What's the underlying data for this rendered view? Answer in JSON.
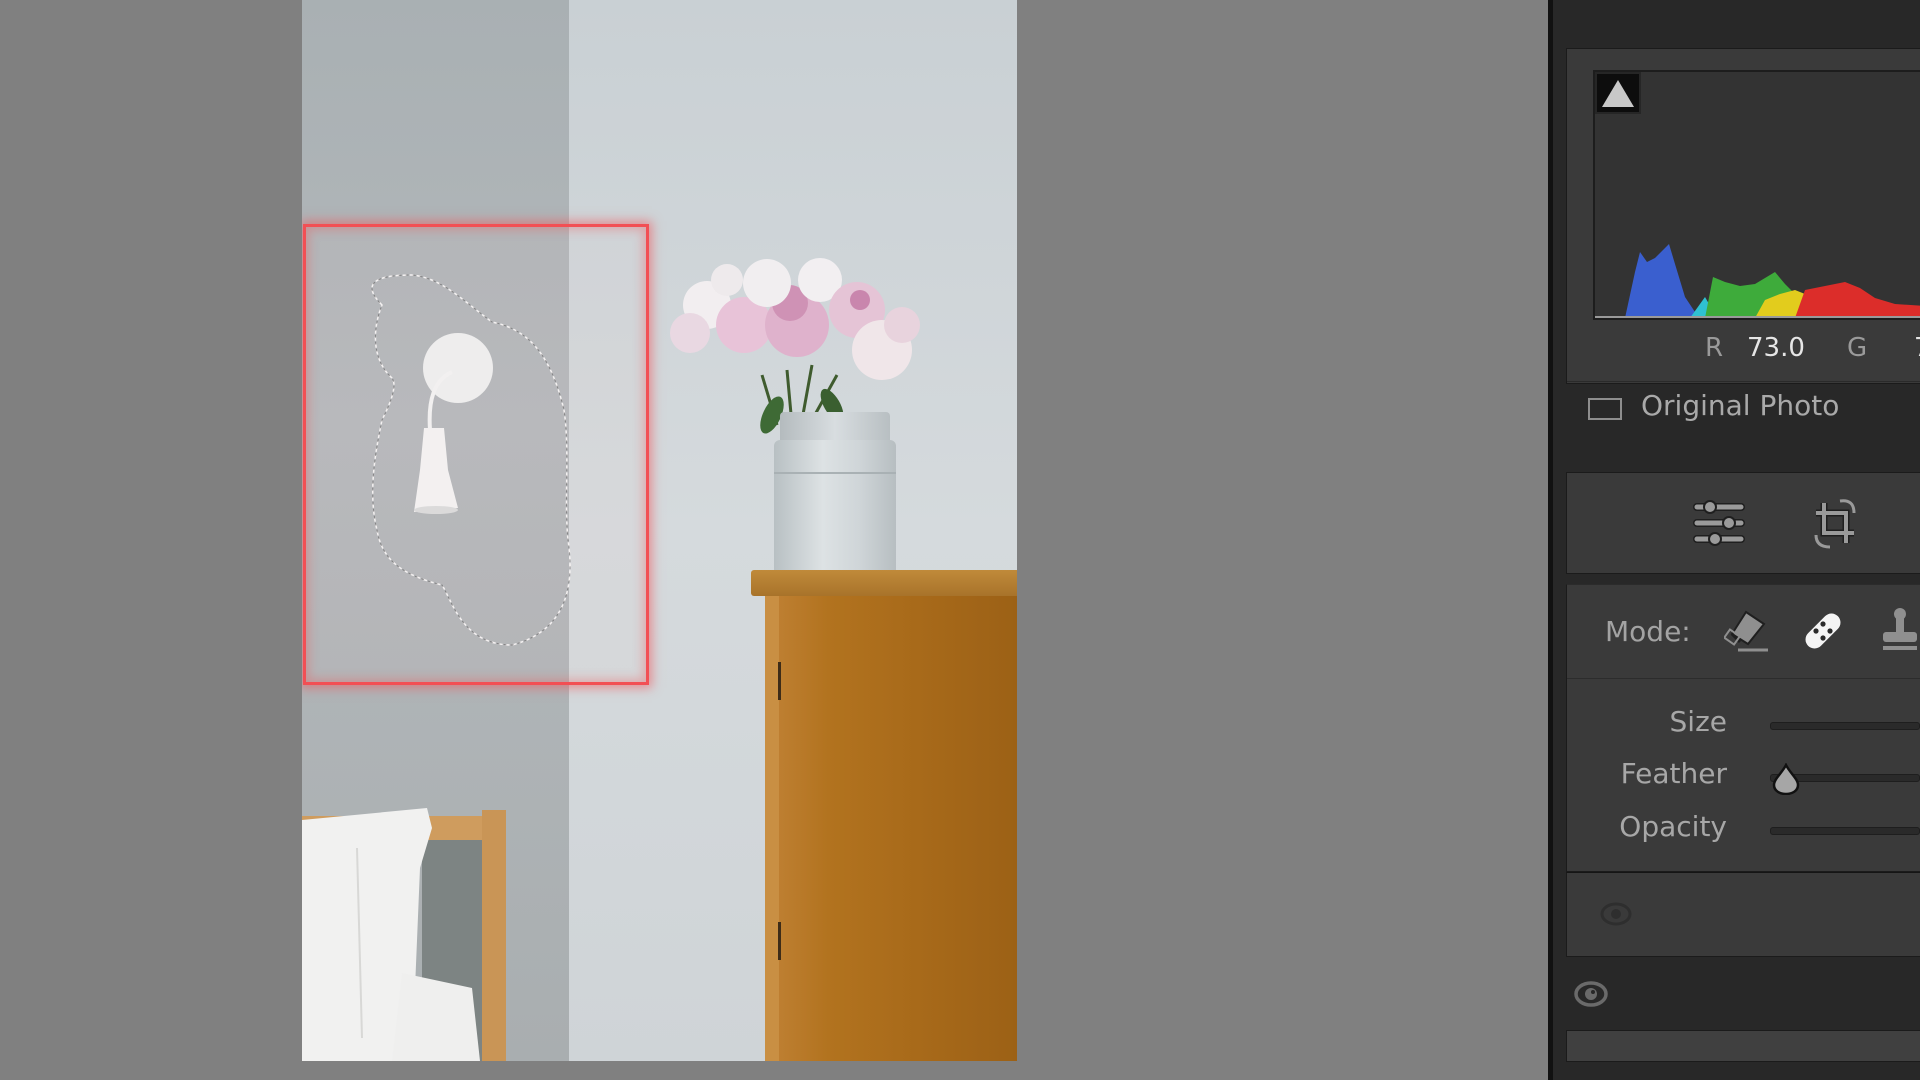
{
  "app": {
    "panel": {
      "histogram": {
        "clipping_warning_icon": "shadow-clipping-triangle-icon",
        "readout": {
          "r_label": "R",
          "r_value": "73.0",
          "g_label": "G",
          "g_value_partial": "7"
        }
      },
      "original_photo": {
        "label": "Original Photo",
        "checked": false
      },
      "tool_strip": [
        {
          "name": "edit-sliders-icon"
        },
        {
          "name": "crop-rotate-icon"
        }
      ],
      "mode": {
        "label": "Mode:",
        "options": [
          {
            "name": "content-aware-remove-icon",
            "active": false
          },
          {
            "name": "heal-bandage-icon",
            "active": true
          },
          {
            "name": "clone-stamp-icon",
            "active": false
          }
        ]
      },
      "sliders": [
        {
          "label": "Size"
        },
        {
          "label": "Feather",
          "value_fraction": 0.0
        },
        {
          "label": "Opacity"
        }
      ]
    },
    "canvas": {
      "selection_highlight_color": "#f24f54",
      "photo_subject": "wall lamp, peony vase on wooden cabinet, bed corner"
    }
  }
}
